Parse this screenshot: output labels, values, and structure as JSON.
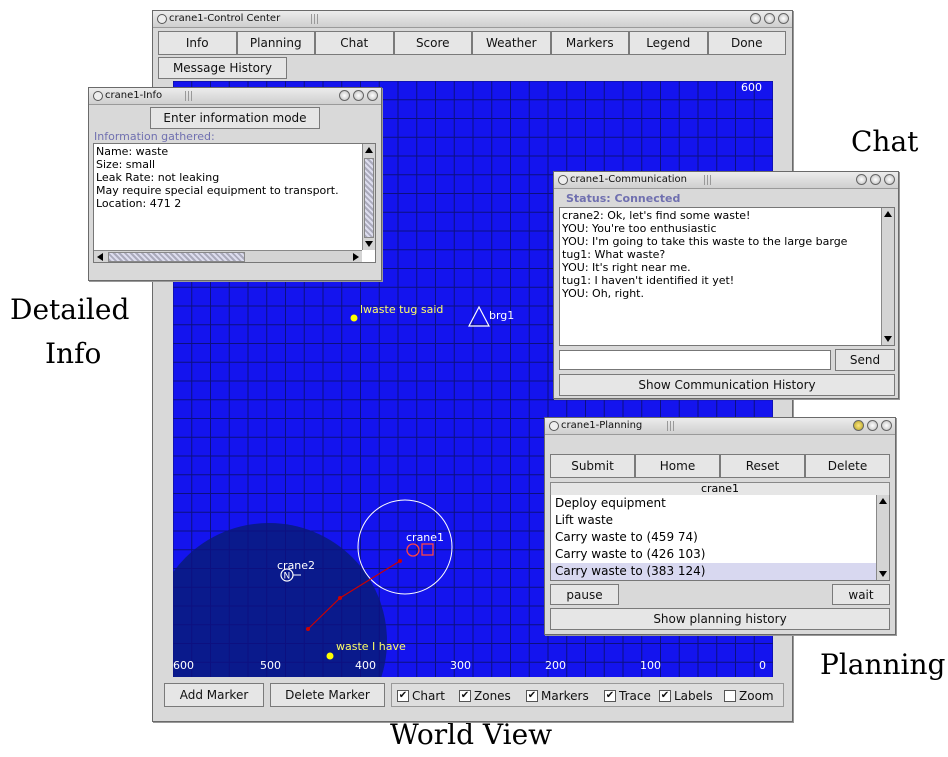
{
  "captions": {
    "chat": "Chat",
    "detailed": "Detailed",
    "info": "Info",
    "planning": "Planning",
    "world_view": "World View"
  },
  "control": {
    "title": "crane1-Control Center",
    "menu": [
      "Info",
      "Planning",
      "Chat",
      "Score",
      "Weather",
      "Markers",
      "Legend",
      "Done"
    ],
    "message_history": "Message History",
    "add_marker": "Add Marker",
    "delete_marker": "Delete Marker",
    "checks": [
      {
        "label": "Chart",
        "checked": true
      },
      {
        "label": "Zones",
        "checked": true
      },
      {
        "label": "Markers",
        "checked": true
      },
      {
        "label": "Trace",
        "checked": true
      },
      {
        "label": "Labels",
        "checked": true
      },
      {
        "label": "Zoom",
        "checked": false
      }
    ]
  },
  "map": {
    "top_right_label": "600",
    "x_ticks": [
      "600",
      "500",
      "400",
      "300",
      "200",
      "100",
      "0"
    ],
    "labels": {
      "waste_tug": "lwaste tug said",
      "brg1": "brg1",
      "crane2": "crane2",
      "crane1": "crane1",
      "waste_have": "waste I have",
      "crane2_marker": "N"
    },
    "colors": {
      "ocean": "#1414ee",
      "zone": "#0a1a8c",
      "grid": "#0c1080",
      "marker": "#ffff00",
      "trace": "#cc0000"
    }
  },
  "info_win": {
    "title": "crane1-Info",
    "enter_button": "Enter information mode",
    "gathered_label": "Information gathered:",
    "lines": [
      "Name: waste",
      "Size: small",
      "Leak Rate: not leaking",
      "May require special equipment to transport.",
      "Location: 471 2"
    ]
  },
  "comm_win": {
    "title": "crane1-Communication",
    "status": "Status: Connected",
    "messages": [
      "crane2: Ok, let's find some waste!",
      "YOU: You're too enthusiastic",
      "YOU: I'm going to take this waste to the large barge",
      "tug1: What waste?",
      "YOU: It's right near me.",
      "tug1: I haven't identified it yet!",
      "YOU: Oh, right."
    ],
    "input_value": "",
    "send": "Send",
    "history": "Show Communication History"
  },
  "plan_win": {
    "title": "crane1-Planning",
    "buttons": [
      "Submit",
      "Home",
      "Reset",
      "Delete"
    ],
    "header": "crane1",
    "items": [
      "Deploy equipment",
      "Lift waste",
      "Carry waste to (459 74)",
      "Carry waste to (426 103)",
      "Carry waste to (383 124)"
    ],
    "selected_index": 4,
    "pause": "pause",
    "wait": "wait",
    "history": "Show planning history"
  }
}
